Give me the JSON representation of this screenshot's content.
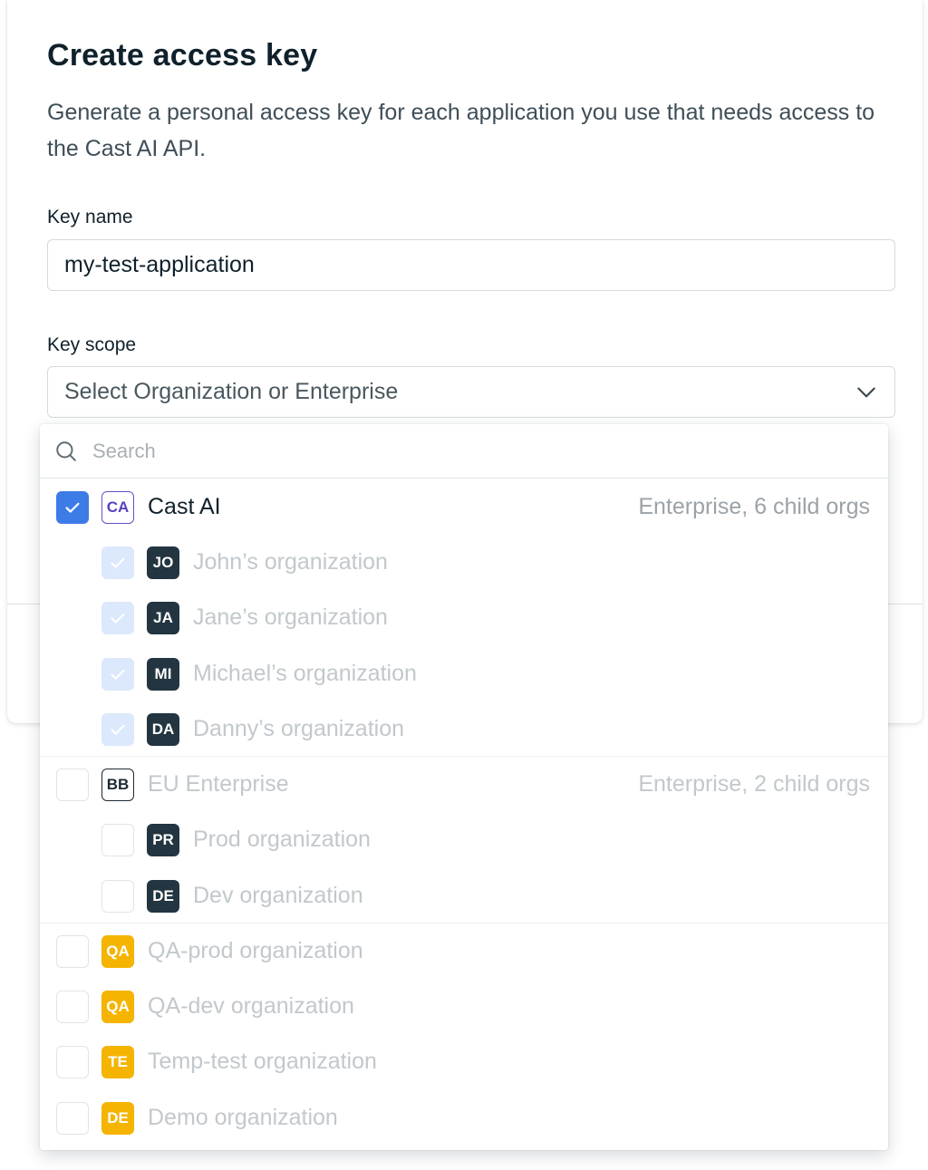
{
  "modal": {
    "title": "Create access key",
    "description": "Generate a personal access key for each application you use that needs access to the Cast AI API.",
    "key_name_label": "Key name",
    "key_name_value": "my-test-application",
    "key_scope_label": "Key scope",
    "key_scope_placeholder": "Select Organization or Enterprise"
  },
  "dropdown": {
    "search_placeholder": "Search",
    "groups": [
      {
        "initials": "CA",
        "name": "Cast AI",
        "meta": "Enterprise, 6 child orgs",
        "checked": true,
        "children": [
          {
            "initials": "JO",
            "name": "John’s organization"
          },
          {
            "initials": "JA",
            "name": "Jane’s organization"
          },
          {
            "initials": "MI",
            "name": "Michael’s organization"
          },
          {
            "initials": "DA",
            "name": "Danny’s organization"
          }
        ]
      },
      {
        "initials": "BB",
        "name": "EU Enterprise",
        "meta": "Enterprise, 2 child orgs",
        "checked": false,
        "children": [
          {
            "initials": "PR",
            "name": "Prod organization"
          },
          {
            "initials": "DE",
            "name": "Dev organization"
          }
        ]
      }
    ],
    "standalone": [
      {
        "initials": "QA",
        "name": "QA-prod organization"
      },
      {
        "initials": "QA",
        "name": "QA-dev organization"
      },
      {
        "initials": "TE",
        "name": "Temp-test organization"
      },
      {
        "initials": "DE",
        "name": "Demo organization"
      }
    ]
  },
  "colors": {
    "accent": "#3d7be6",
    "accent_soft": "#dce8fb",
    "avatar_dark": "#223540",
    "avatar_amber": "#f4b400",
    "enterprise_purple": "#5a3fbf"
  },
  "icons": {
    "search": "search-icon",
    "chevron": "chevron-down-icon",
    "check": "check-icon"
  }
}
